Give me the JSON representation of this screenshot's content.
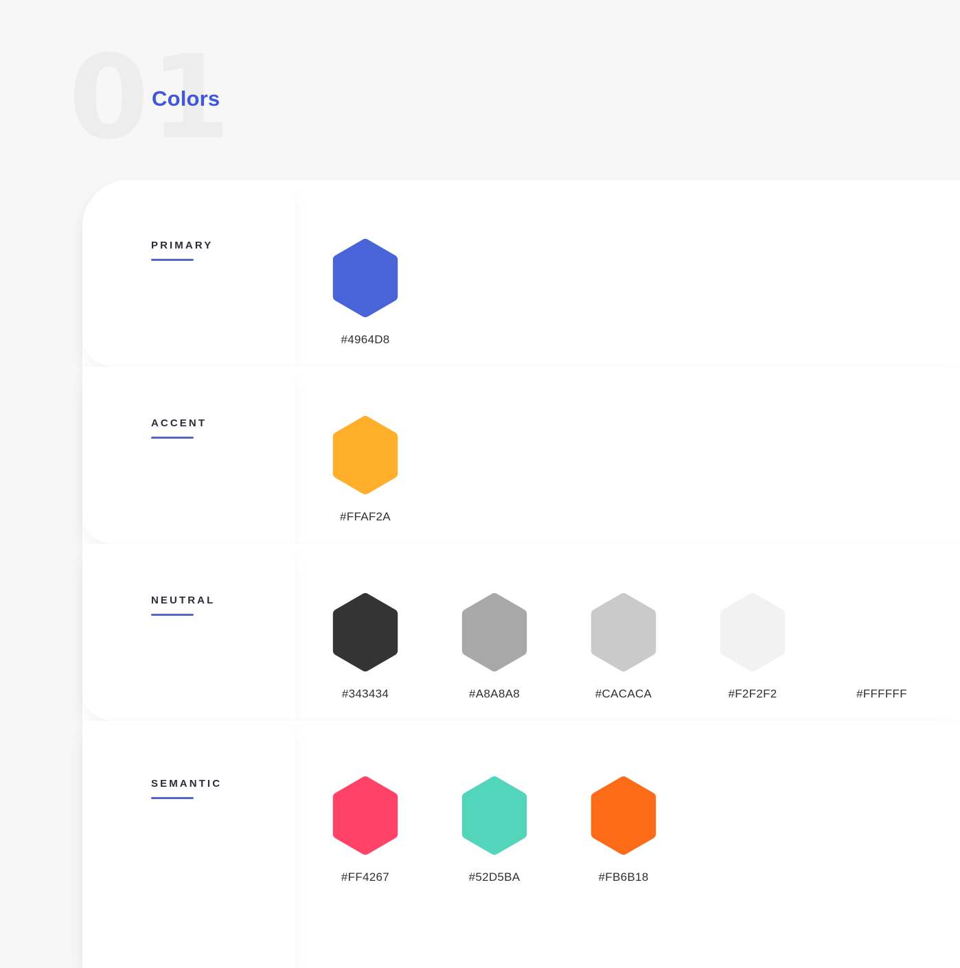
{
  "header": {
    "number": "01",
    "title": "Colors"
  },
  "accent_color": "#3F57D8",
  "rule_color": "#5465C4",
  "page_background": "#F7F7F7",
  "card_background": "#FFFFFF",
  "groups": [
    {
      "label": "PRIMARY",
      "swatches": [
        {
          "hex": "#4964D8",
          "code": "#4964D8"
        }
      ]
    },
    {
      "label": "ACCENT",
      "swatches": [
        {
          "hex": "#FFAF2A",
          "code": "#FFAF2A"
        }
      ]
    },
    {
      "label": "NEUTRAL",
      "swatches": [
        {
          "hex": "#343434",
          "code": "#343434"
        },
        {
          "hex": "#A8A8A8",
          "code": "#A8A8A8"
        },
        {
          "hex": "#CACACA",
          "code": "#CACACA"
        },
        {
          "hex": "#F2F2F2",
          "code": "#F2F2F2"
        },
        {
          "hex": "#FFFFFF",
          "code": "#FFFFFF"
        }
      ]
    },
    {
      "label": "SEMANTIC",
      "swatches": [
        {
          "hex": "#FF4267",
          "code": "#FF4267"
        },
        {
          "hex": "#52D5BA",
          "code": "#52D5BA"
        },
        {
          "hex": "#FB6B18",
          "code": "#FB6B18"
        }
      ]
    }
  ]
}
